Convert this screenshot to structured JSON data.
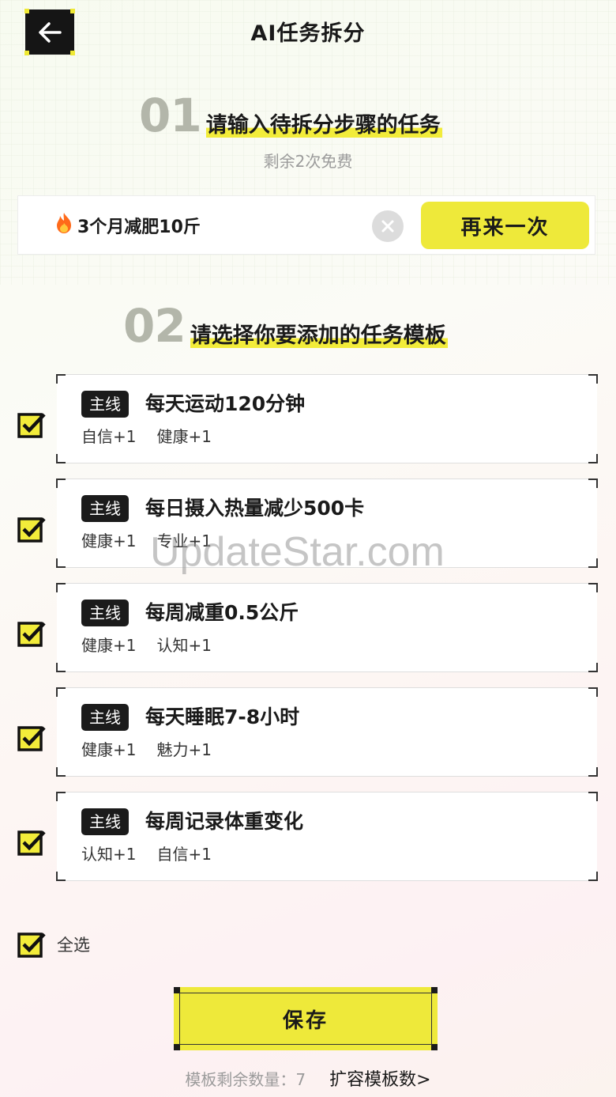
{
  "header": {
    "back_icon": "arrow-left-icon",
    "title": "AI任务拆分"
  },
  "step1": {
    "number": "01",
    "title": "请输入待拆分步骤的任务",
    "remaining": "剩余2次免费"
  },
  "input": {
    "icon": "fire-icon",
    "value": "3个月减肥10斤",
    "clear_icon": "close-icon",
    "retry_label": "再来一次"
  },
  "step2": {
    "number": "02",
    "title": "请选择你要添加的任务模板"
  },
  "tasks": [
    {
      "checked": true,
      "tag": "主线",
      "title": "每天运动120分钟",
      "attrs": [
        "自信+1",
        "健康+1"
      ]
    },
    {
      "checked": true,
      "tag": "主线",
      "title": "每日摄入热量减少500卡",
      "attrs": [
        "健康+1",
        "专业+1"
      ]
    },
    {
      "checked": true,
      "tag": "主线",
      "title": "每周减重0.5公斤",
      "attrs": [
        "健康+1",
        "认知+1"
      ]
    },
    {
      "checked": true,
      "tag": "主线",
      "title": "每天睡眠7-8小时",
      "attrs": [
        "健康+1",
        "魅力+1"
      ]
    },
    {
      "checked": true,
      "tag": "主线",
      "title": "每周记录体重变化",
      "attrs": [
        "认知+1",
        "自信+1"
      ]
    }
  ],
  "select_all": {
    "checked": true,
    "label": "全选"
  },
  "save_label": "保存",
  "footer": {
    "remaining_label": "模板剩余数量：7",
    "expand_link": "扩容模板数>"
  },
  "watermark": "UpdateStar.com",
  "colors": {
    "accent_yellow": "#eee93a",
    "dark": "#1b1b1b",
    "muted": "#9b9b9b"
  }
}
